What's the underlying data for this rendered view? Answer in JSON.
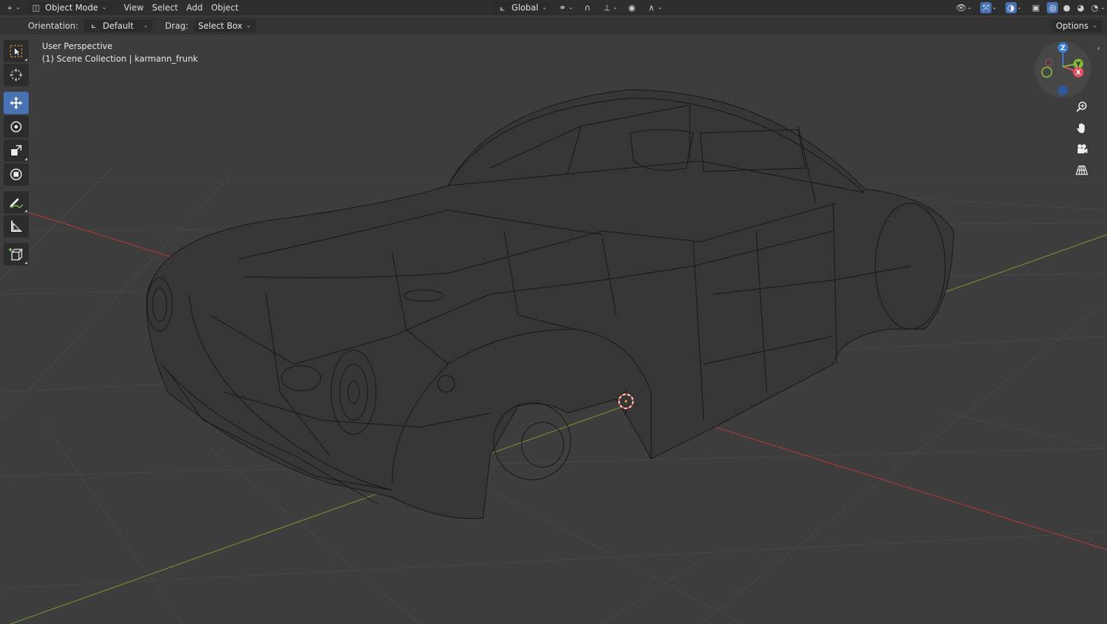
{
  "header": {
    "editor_type_icon": "3d-viewport-icon",
    "mode": "Object Mode",
    "menus": [
      "View",
      "Select",
      "Add",
      "Object"
    ],
    "transform_orientation": "Global",
    "icons": {
      "pivot": "pivot-point-icon",
      "snap": "magnet-icon",
      "proportional": "proportional-edit-icon",
      "visibility": "eye-icon",
      "gizmo": "gizmo-icon",
      "overlay": "overlay-icon",
      "xray": "xray-icon",
      "wireframe": "wireframe-shading-icon",
      "solid": "solid-shading-icon",
      "material": "material-shading-icon",
      "rendered": "rendered-shading-icon"
    }
  },
  "toolsettings": {
    "orientation_label": "Orientation:",
    "orientation_value": "Default",
    "drag_label": "Drag:",
    "drag_value": "Select Box",
    "options_label": "Options"
  },
  "toolbar": {
    "tools": [
      "select-box",
      "cursor",
      "move",
      "rotate",
      "scale",
      "transform",
      "annotate",
      "measure",
      "add-cube"
    ],
    "active_tool": "move"
  },
  "viewport_info": {
    "perspective": "User Perspective",
    "collection": "(1) Scene Collection | karmann_frunk"
  },
  "gizmo": {
    "x_label": "X",
    "y_label": "Y",
    "z_label": "Z",
    "colors": {
      "x": "#e84a5f",
      "y": "#7fbc33",
      "z": "#3a7ad8"
    }
  },
  "colors": {
    "background": "#3d3d3d",
    "grid": "#4a4a4a",
    "axis_x": "#a93a3a",
    "axis_y": "#6d8f2d",
    "wire": "#141414",
    "active_tool": "#4772b3"
  }
}
